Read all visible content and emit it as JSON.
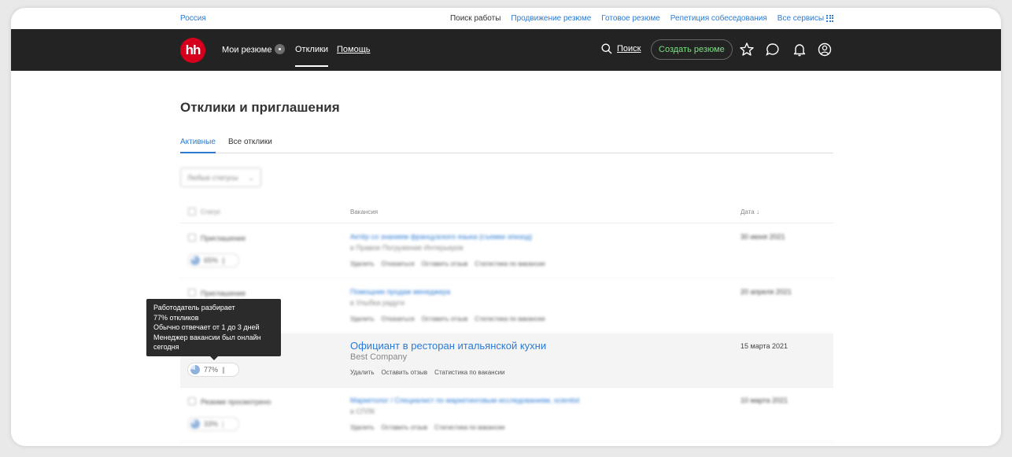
{
  "topbar": {
    "region": "Россия",
    "links": [
      "Поиск работы",
      "Продвижение резюме",
      "Готовое резюме",
      "Репетиция собеседования",
      "Все сервисы"
    ]
  },
  "navbar": {
    "logo": "hh",
    "my_resumes": "Мои резюме",
    "responses": "Отклики",
    "help": "Помощь",
    "search": "Поиск",
    "create_resume": "Создать резюме"
  },
  "page": {
    "title": "Отклики и приглашения",
    "tabs": [
      "Активные",
      "Все отклики"
    ],
    "filter_label": "Любые статусы"
  },
  "table": {
    "headers": {
      "status": "Статус",
      "vacancy": "Вакансия",
      "date": "Дата ↓"
    },
    "rows": [
      {
        "status": "Приглашение",
        "percent": "65%",
        "title": "Актёр со знанием французского языка (съемки эпизод)",
        "company": "в Правое Погружение Интерьеров",
        "actions": [
          "Удалить",
          "Отказаться",
          "Оставить отзыв",
          "Статистика по вакансии"
        ],
        "date": "30 июня 2021"
      },
      {
        "status": "Приглашение",
        "percent": "",
        "title": "Помощник продаж менеджера",
        "company": "в Улыбка радуги",
        "actions": [
          "Удалить",
          "Отказаться",
          "Оставить отзыв",
          "Статистика по вакансии"
        ],
        "date": "20 апреля 2021"
      },
      {
        "status": "",
        "percent": "77%",
        "title": "Официант в ресторан итальянской кухни",
        "company": "Best Company",
        "actions": [
          "Удалить",
          "Оставить отзыв",
          "Статистика по вакансии"
        ],
        "date": "15 марта 2021"
      },
      {
        "status": "Резюме просмотрено",
        "percent": "33%",
        "title": "Маркетолог / Специалист по маркетинговым исследованиям, scientist",
        "company": "в СПЛК",
        "actions": [
          "Удалить",
          "Оставить отзыв",
          "Статистика по вакансии"
        ],
        "date": "10 марта 2021"
      }
    ]
  },
  "tooltip": {
    "lines": [
      "Работодатель разбирает",
      "77% откликов",
      "Обычно отвечает от 1 до 3 дней",
      "Менеджер вакансии был онлайн",
      "сегодня"
    ]
  },
  "colors": {
    "brand": "#d6001c",
    "link": "#2b7bd4",
    "navbar": "#232323",
    "create_button_text": "#7ddf82"
  }
}
